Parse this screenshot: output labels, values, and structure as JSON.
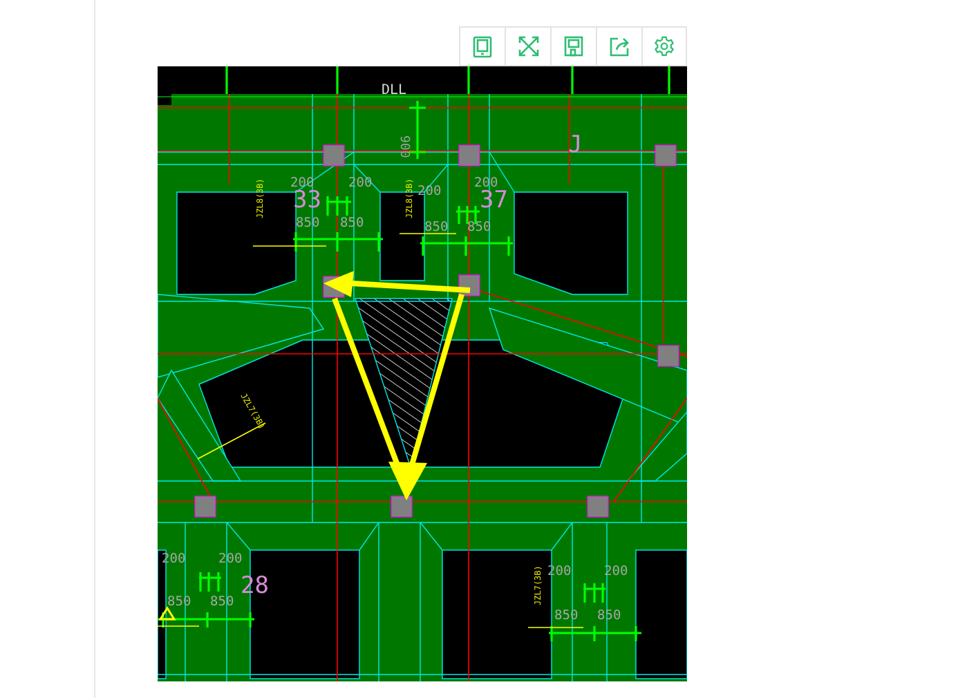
{
  "toolbar": {
    "buttons": [
      {
        "kind": "tablet"
      },
      {
        "kind": "fullscreen"
      },
      {
        "kind": "save"
      },
      {
        "kind": "share"
      },
      {
        "kind": "settings"
      }
    ]
  },
  "drawing": {
    "labels": [
      {
        "text": "DLL",
        "kind": "title"
      },
      {
        "text": "900",
        "kind": "vertical"
      },
      {
        "text": "200",
        "kind": "dimension"
      },
      {
        "text": "200",
        "kind": "dimension"
      },
      {
        "text": "200",
        "kind": "dimension"
      },
      {
        "text": "200",
        "kind": "dimension"
      },
      {
        "text": "33",
        "kind": "mark"
      },
      {
        "text": "37",
        "kind": "mark"
      },
      {
        "text": "J",
        "kind": "mark"
      },
      {
        "text": "850",
        "kind": "dimension"
      },
      {
        "text": "850",
        "kind": "dimension"
      },
      {
        "text": "850",
        "kind": "dimension"
      },
      {
        "text": "850",
        "kind": "dimension"
      },
      {
        "text": "JZL8(3B)",
        "kind": "beam"
      },
      {
        "text": "JZL8(3B)",
        "kind": "beam"
      },
      {
        "text": "JZL7(3B)",
        "kind": "beam"
      },
      {
        "text": "200",
        "kind": "dimension"
      },
      {
        "text": "200",
        "kind": "dimension"
      },
      {
        "text": "28",
        "kind": "mark"
      },
      {
        "text": "850",
        "kind": "dimension"
      },
      {
        "text": "850",
        "kind": "dimension"
      },
      {
        "text": "200",
        "kind": "dimension"
      },
      {
        "text": "200",
        "kind": "dimension"
      },
      {
        "text": "JZL7(3B)",
        "kind": "beam"
      },
      {
        "text": "850",
        "kind": "dimension"
      },
      {
        "text": "850",
        "kind": "dimension"
      }
    ]
  }
}
